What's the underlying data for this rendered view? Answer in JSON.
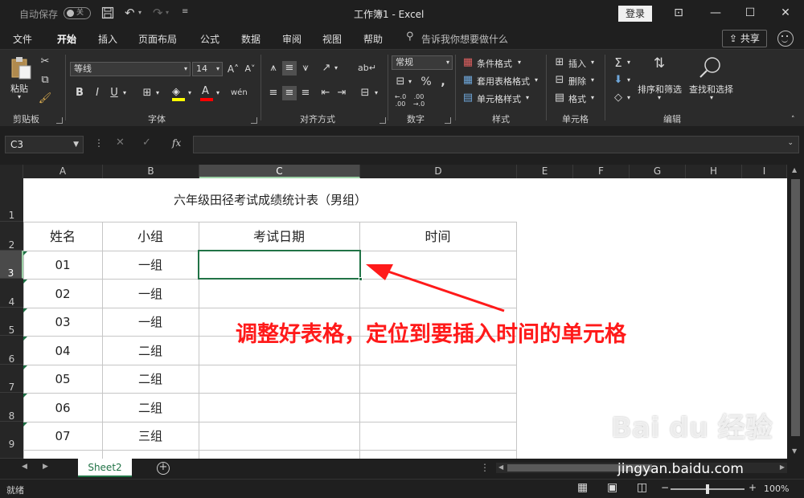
{
  "titlebar": {
    "autosave_label": "自动保存",
    "autosave_state": "关",
    "doc_title": "工作簿1  -  Excel",
    "login_label": "登录"
  },
  "tabs": [
    "文件",
    "开始",
    "插入",
    "页面布局",
    "公式",
    "数据",
    "审阅",
    "视图",
    "帮助"
  ],
  "tell_me": "告诉我你想要做什么",
  "share_label": "共享",
  "ribbon": {
    "clipboard": {
      "label": "剪贴板",
      "paste": "粘贴"
    },
    "font": {
      "label": "字体",
      "font_name": "等线",
      "font_size": "14",
      "bold": "B",
      "italic": "I",
      "underline": "U"
    },
    "alignment": {
      "label": "对齐方式"
    },
    "number": {
      "label": "数字",
      "format": "常规"
    },
    "styles": {
      "label": "样式",
      "conditional": "条件格式",
      "table": "套用表格格式",
      "cell_styles": "单元格样式"
    },
    "cells": {
      "label": "单元格",
      "insert": "插入",
      "delete": "删除",
      "format": "格式"
    },
    "editing": {
      "label": "编辑",
      "sort": "排序和筛选",
      "find": "查找和选择"
    }
  },
  "namebox": "C3",
  "columns": [
    "A",
    "B",
    "C",
    "D",
    "E",
    "F",
    "G",
    "H",
    "I"
  ],
  "rows": [
    "1",
    "2",
    "3",
    "4",
    "5",
    "6",
    "7",
    "8",
    "9"
  ],
  "sheet": {
    "title": "六年级田径考试成绩统计表（男组）",
    "headers": [
      "姓名",
      "小组",
      "考试日期",
      "时间"
    ],
    "data": [
      [
        "01",
        "一组"
      ],
      [
        "02",
        "一组"
      ],
      [
        "03",
        "一组"
      ],
      [
        "04",
        "二组"
      ],
      [
        "05",
        "二组"
      ],
      [
        "06",
        "二组"
      ],
      [
        "07",
        "三组"
      ]
    ]
  },
  "annotation": "调整好表格，定位到要插入时间的单元格",
  "sheet_tab": "Sheet2",
  "status": {
    "ready": "就绪",
    "zoom": "100%"
  },
  "watermark": {
    "logo": "Bai du 经验",
    "url": "jingyan.baidu.com"
  },
  "colors": {
    "selection": "#217346",
    "annotation": "#ff1a1a"
  }
}
